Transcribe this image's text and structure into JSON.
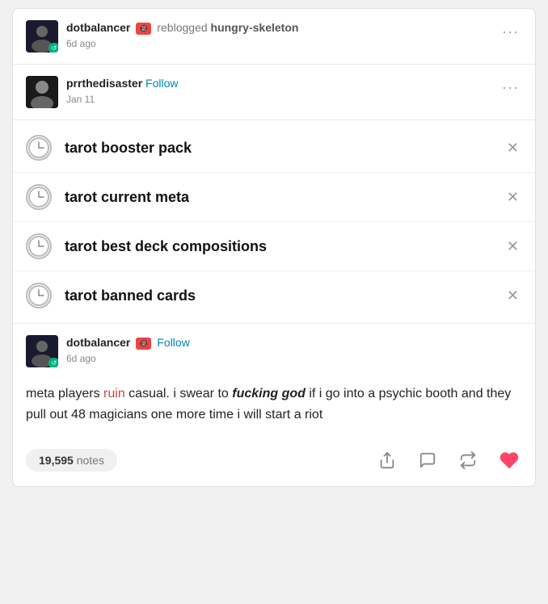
{
  "post1": {
    "username": "dotbalancer",
    "reblogged_label": "reblogged",
    "source_username": "hungry-skeleton",
    "nsfw_badge": "🔞",
    "timestamp": "6d ago",
    "more_label": "···"
  },
  "post2": {
    "username": "prrthedisaster",
    "follow_label": "Follow",
    "timestamp": "Jan 11",
    "more_label": "···"
  },
  "search_items": [
    {
      "text": "tarot booster pack"
    },
    {
      "text": "tarot current meta"
    },
    {
      "text": "tarot best deck compositions"
    },
    {
      "text": "tarot banned cards"
    }
  ],
  "post3": {
    "username": "dotbalancer",
    "follow_label": "Follow",
    "timestamp": "6d ago",
    "body_before": "meta players ",
    "ruin_word": "ruin",
    "body_after": " casual. i swear to ",
    "bold_italic": "fucking god",
    "body_end": " if i go into a psychic booth and they pull out 48 magicians one more time i will start a riot"
  },
  "footer": {
    "notes_number": "19,595",
    "notes_label": "notes"
  }
}
